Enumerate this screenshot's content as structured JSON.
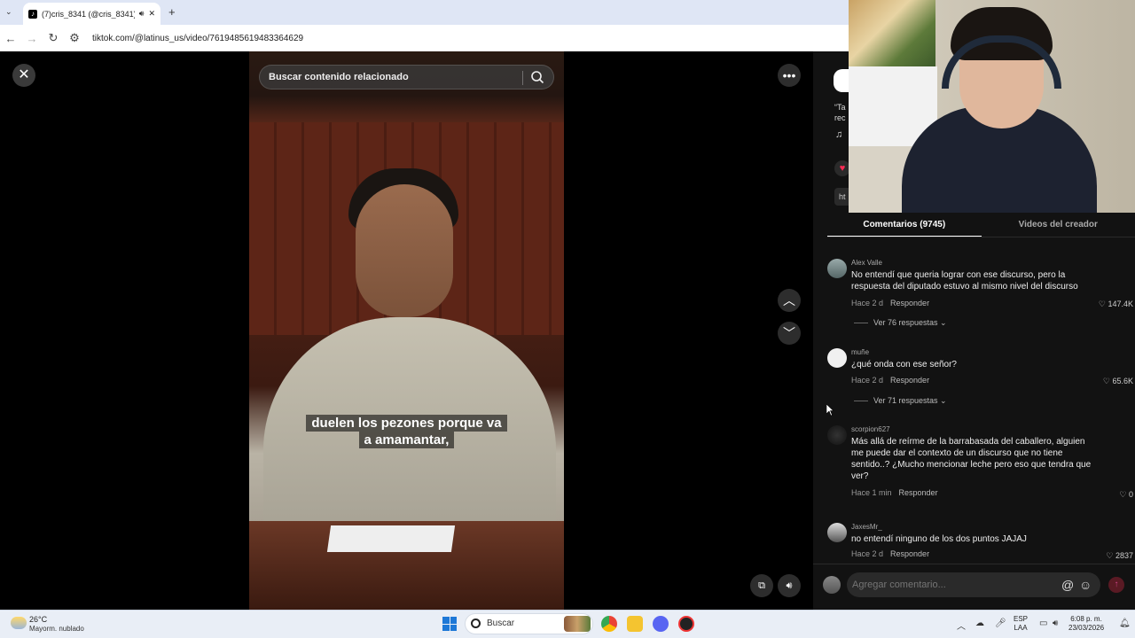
{
  "browser": {
    "tab_title": "(7)cris_8341 (@cris_8341) |",
    "url": "tiktok.com/@latinus_us/video/7619485619483364629"
  },
  "video": {
    "search_placeholder": "Buscar contenido relacionado",
    "caption_line1": "duelen los pezones porque va",
    "caption_line2": "a amamantar,"
  },
  "info_fragments": {
    "desc_a": "“Ta",
    "desc_b": "rec",
    "music_icon": "music-note-icon",
    "chip": "ht"
  },
  "comments_panel": {
    "tab_comments": "Comentarios (9745)",
    "tab_creator": "Videos del creador",
    "reply_label": "Responder",
    "comments": [
      {
        "user": "Alex Valle",
        "text": "No entendí que queria lograr con ese discurso, pero la respuesta del diputado estuvo al mismo nivel del discurso",
        "time": "Hace 2 d",
        "likes": "147.4K",
        "replies": "Ver 76 respuestas"
      },
      {
        "user": "muñe",
        "text": "¿qué onda con ese señor?",
        "time": "Hace 2 d",
        "likes": "65.6K",
        "replies": "Ver 71 respuestas"
      },
      {
        "user": "scorpion627",
        "text": "Más allá de reírme de la barrabasada del caballero, alguien me puede dar el contexto de un discurso que no tiene sentido..? ¿Mucho mencionar leche pero eso que tendra que ver?",
        "time": "Hace 1 min",
        "likes": "0"
      },
      {
        "user": "JaxesMr_",
        "text": "no entendí ninguno de los dos puntos JAJAJ",
        "time": "Hace 2 d",
        "likes": "2837"
      }
    ],
    "input_placeholder": "Agregar comentario..."
  },
  "taskbar": {
    "temp": "26°C",
    "weather": "Mayorm. nublado",
    "search": "Buscar",
    "lang_line1": "ESP",
    "lang_line2": "LAA",
    "time": "6:08 p. m.",
    "date": "23/03/2026"
  },
  "colors": {
    "tiktok_red": "#fe2c55",
    "panel_bg": "#121212",
    "taskbar_bg": "#e9eef6"
  }
}
